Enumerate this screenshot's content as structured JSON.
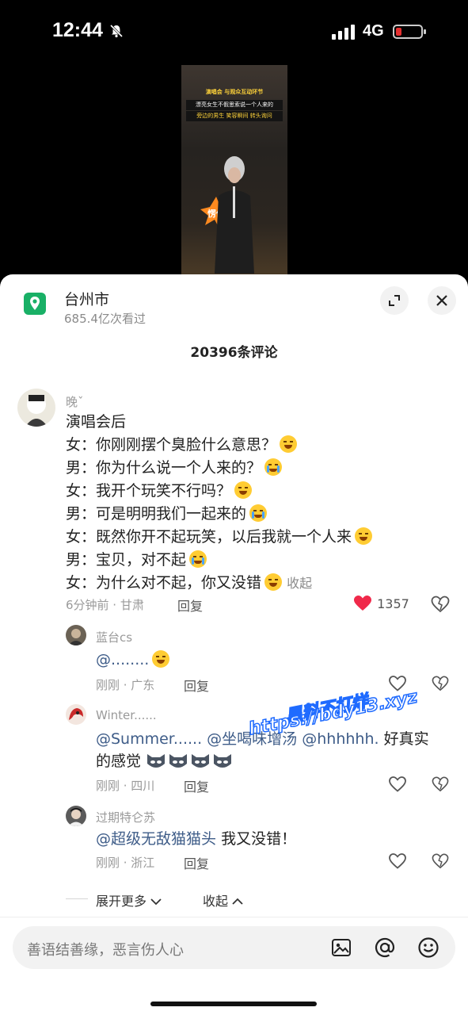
{
  "status": {
    "time": "12:44",
    "network": "4G",
    "battery_level": 0.22,
    "battery_color": "#e53030"
  },
  "video": {
    "captions": [
      "演唱会 与观众互动环节",
      "漂亮女生不假思索说一个人来的",
      "旁边的男生 笑容瞬间 转头询问"
    ],
    "sticker": "愣住"
  },
  "location": {
    "name": "台州市",
    "views": "685.4亿次看过"
  },
  "comments_title": "20396条评论",
  "main_comment": {
    "username": "晚ˇ",
    "lines": [
      "演唱会后",
      "女：你刚刚摆个臭脸什么意思？",
      "男：你为什么说一个人来的？",
      "女：我开个玩笑不行吗？",
      "男：可是明明我们一起来的",
      "女：既然你开不起玩笑，以后我就一个人来",
      "男：宝贝，对不起",
      "女：为什么对不起，你又没错"
    ],
    "collapse_label": "收起",
    "meta": "6分钟前 · 甘肃",
    "reply_label": "回复",
    "likes": "1357",
    "like_color": "#f0294a"
  },
  "replies": [
    {
      "username": "蓝台cs",
      "text": "@........",
      "meta": "刚刚 · 广东",
      "reply_label": "回复"
    },
    {
      "username": "Winter......",
      "mentions": [
        "@Summer......",
        "@坐喝味增汤",
        "@hhhhhh."
      ],
      "text_tail": "好真实",
      "text_line2": "的感觉",
      "meta": "刚刚 · 四川",
      "reply_label": "回复"
    },
    {
      "username": "过期特仑苏",
      "mention": "@超级无敌猫猫头",
      "text_tail": "我又没错！",
      "meta": "刚刚 · 浙江",
      "reply_label": "回复"
    }
  ],
  "expand_label": "展开更多",
  "collapse_label": "收起",
  "input_placeholder": "善语结善缘，恶言伤人心",
  "watermark": {
    "line1": "黑料不打烊",
    "line2": "https://bdy13.xyz"
  },
  "accent_green": "#19b066",
  "mention_color": "#3e5c88"
}
